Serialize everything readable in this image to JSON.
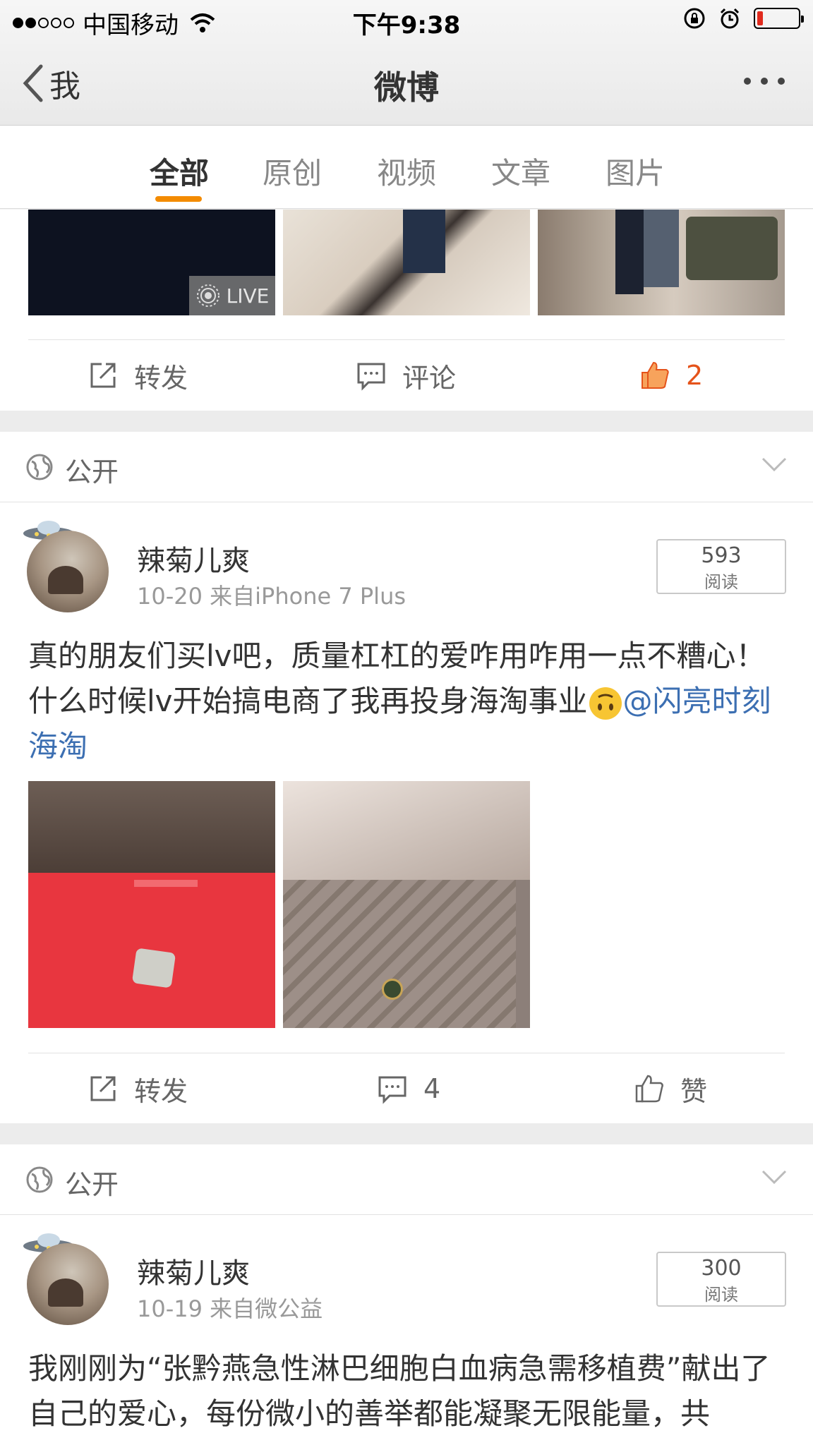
{
  "status_bar": {
    "carrier": "中国移动",
    "time": "下午9:38",
    "signal_bars_filled": 2,
    "signal_bars_total": 5,
    "battery_level": 0.1,
    "battery_color": "#e12b1e"
  },
  "nav": {
    "back_label": "我",
    "title": "微博"
  },
  "tabs": [
    {
      "label": "全部",
      "active": true
    },
    {
      "label": "原创",
      "active": false
    },
    {
      "label": "视频",
      "active": false
    },
    {
      "label": "文章",
      "active": false
    },
    {
      "label": "图片",
      "active": false
    }
  ],
  "accent_color": "#f38b00",
  "link_color": "#3c6fb2",
  "like_active_color": "#e5531a",
  "post0": {
    "live_label": "LIVE",
    "actions": {
      "repost": "转发",
      "comment": "评论",
      "like": "2"
    }
  },
  "post1": {
    "visibility": "公开",
    "username": "辣菊儿爽",
    "meta": "10-20  来自iPhone 7 Plus",
    "reads": "593",
    "reads_label": "阅读",
    "text": "真的朋友们买lv吧，质量杠杠的爱咋用咋用一点不糟心！什么时候lv开始搞电商了我再投身海淘事业",
    "mention": "@闪亮时刻海淘",
    "actions": {
      "repost": "转发",
      "comment": "4",
      "like": "赞"
    }
  },
  "post2": {
    "visibility": "公开",
    "username": "辣菊儿爽",
    "meta": "10-19  来自微公益",
    "reads": "300",
    "reads_label": "阅读",
    "text": "我刚刚为“张黔燕急性淋巴细胞白血病急需移植费”献出了自己的爱心，每份微小的善举都能凝聚无限能量，共"
  }
}
